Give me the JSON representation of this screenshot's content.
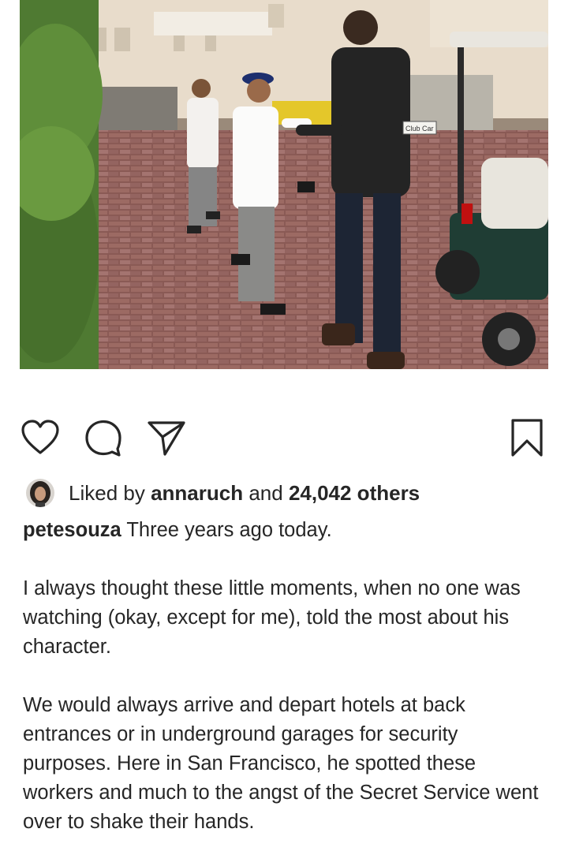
{
  "post": {
    "photo_alt_name": "post-photo",
    "photo_sign_text": "Club Car"
  },
  "actions": {
    "like_icon": "heart-icon",
    "comment_icon": "comment-icon",
    "share_icon": "paper-plane-icon",
    "save_icon": "bookmark-icon"
  },
  "likes": {
    "prefix": "Liked by ",
    "user": "annaruch",
    "middle": " and ",
    "count": "24,042 others"
  },
  "caption": {
    "author": "petesouza",
    "first_line": " Three years ago today.",
    "paragraph_2": "I always thought these little moments, when no one was watching (okay, except for me), told the most about his character.",
    "paragraph_3": "We would always arrive and depart hotels at back entrances or in underground garages for security purposes. Here in San Francisco, he spotted these workers and much to the angst of the Secret Service went over to shake their hands."
  },
  "colors": {
    "text": "#262626",
    "icon": "#262626",
    "background": "#ffffff"
  }
}
